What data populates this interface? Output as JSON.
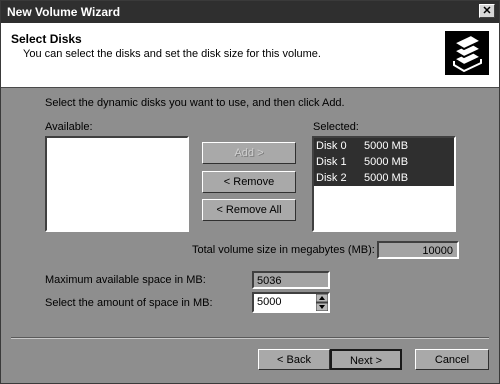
{
  "window": {
    "title": "New Volume Wizard",
    "close_glyph": "✕"
  },
  "header": {
    "title": "Select Disks",
    "subtitle": "You can select the disks and set the disk size for this volume."
  },
  "instructions": "Select the dynamic disks you want to use, and then click Add.",
  "available": {
    "label": "Available:"
  },
  "selected": {
    "label": "Selected:",
    "items": [
      {
        "disk": "Disk 0",
        "size": "5000 MB"
      },
      {
        "disk": "Disk 1",
        "size": "5000 MB"
      },
      {
        "disk": "Disk 2",
        "size": "5000 MB"
      }
    ]
  },
  "buttons": {
    "add": "Add >",
    "remove": "< Remove",
    "remove_all": "< Remove All"
  },
  "total": {
    "label": "Total volume size in megabytes (MB):",
    "value": "10000"
  },
  "max_space": {
    "label": "Maximum available space in MB:",
    "value": "5036"
  },
  "select_space": {
    "label": "Select the amount of space in MB:",
    "value": "5000"
  },
  "footer": {
    "back": "< Back",
    "next": "Next >",
    "cancel": "Cancel"
  },
  "icons": {
    "header": "stacked-disks-icon",
    "spin": "spinner-arrows-icon"
  }
}
